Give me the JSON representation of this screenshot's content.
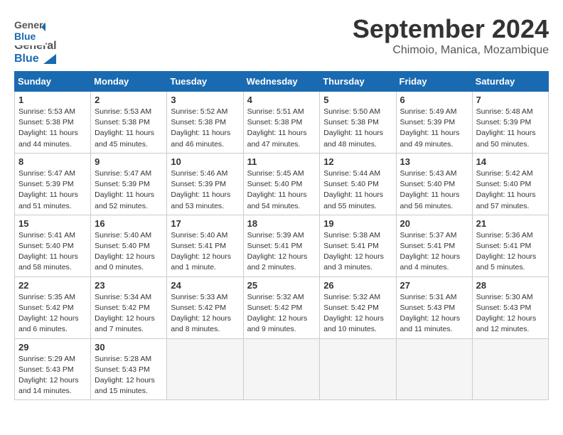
{
  "header": {
    "logo_line1": "General",
    "logo_line2": "Blue",
    "month": "September 2024",
    "location": "Chimoio, Manica, Mozambique"
  },
  "weekdays": [
    "Sunday",
    "Monday",
    "Tuesday",
    "Wednesday",
    "Thursday",
    "Friday",
    "Saturday"
  ],
  "weeks": [
    [
      {
        "day": "1",
        "info": "Sunrise: 5:53 AM\nSunset: 5:38 PM\nDaylight: 11 hours\nand 44 minutes."
      },
      {
        "day": "2",
        "info": "Sunrise: 5:53 AM\nSunset: 5:38 PM\nDaylight: 11 hours\nand 45 minutes."
      },
      {
        "day": "3",
        "info": "Sunrise: 5:52 AM\nSunset: 5:38 PM\nDaylight: 11 hours\nand 46 minutes."
      },
      {
        "day": "4",
        "info": "Sunrise: 5:51 AM\nSunset: 5:38 PM\nDaylight: 11 hours\nand 47 minutes."
      },
      {
        "day": "5",
        "info": "Sunrise: 5:50 AM\nSunset: 5:38 PM\nDaylight: 11 hours\nand 48 minutes."
      },
      {
        "day": "6",
        "info": "Sunrise: 5:49 AM\nSunset: 5:39 PM\nDaylight: 11 hours\nand 49 minutes."
      },
      {
        "day": "7",
        "info": "Sunrise: 5:48 AM\nSunset: 5:39 PM\nDaylight: 11 hours\nand 50 minutes."
      }
    ],
    [
      {
        "day": "8",
        "info": "Sunrise: 5:47 AM\nSunset: 5:39 PM\nDaylight: 11 hours\nand 51 minutes."
      },
      {
        "day": "9",
        "info": "Sunrise: 5:47 AM\nSunset: 5:39 PM\nDaylight: 11 hours\nand 52 minutes."
      },
      {
        "day": "10",
        "info": "Sunrise: 5:46 AM\nSunset: 5:39 PM\nDaylight: 11 hours\nand 53 minutes."
      },
      {
        "day": "11",
        "info": "Sunrise: 5:45 AM\nSunset: 5:40 PM\nDaylight: 11 hours\nand 54 minutes."
      },
      {
        "day": "12",
        "info": "Sunrise: 5:44 AM\nSunset: 5:40 PM\nDaylight: 11 hours\nand 55 minutes."
      },
      {
        "day": "13",
        "info": "Sunrise: 5:43 AM\nSunset: 5:40 PM\nDaylight: 11 hours\nand 56 minutes."
      },
      {
        "day": "14",
        "info": "Sunrise: 5:42 AM\nSunset: 5:40 PM\nDaylight: 11 hours\nand 57 minutes."
      }
    ],
    [
      {
        "day": "15",
        "info": "Sunrise: 5:41 AM\nSunset: 5:40 PM\nDaylight: 11 hours\nand 58 minutes."
      },
      {
        "day": "16",
        "info": "Sunrise: 5:40 AM\nSunset: 5:40 PM\nDaylight: 12 hours\nand 0 minutes."
      },
      {
        "day": "17",
        "info": "Sunrise: 5:40 AM\nSunset: 5:41 PM\nDaylight: 12 hours\nand 1 minute."
      },
      {
        "day": "18",
        "info": "Sunrise: 5:39 AM\nSunset: 5:41 PM\nDaylight: 12 hours\nand 2 minutes."
      },
      {
        "day": "19",
        "info": "Sunrise: 5:38 AM\nSunset: 5:41 PM\nDaylight: 12 hours\nand 3 minutes."
      },
      {
        "day": "20",
        "info": "Sunrise: 5:37 AM\nSunset: 5:41 PM\nDaylight: 12 hours\nand 4 minutes."
      },
      {
        "day": "21",
        "info": "Sunrise: 5:36 AM\nSunset: 5:41 PM\nDaylight: 12 hours\nand 5 minutes."
      }
    ],
    [
      {
        "day": "22",
        "info": "Sunrise: 5:35 AM\nSunset: 5:42 PM\nDaylight: 12 hours\nand 6 minutes."
      },
      {
        "day": "23",
        "info": "Sunrise: 5:34 AM\nSunset: 5:42 PM\nDaylight: 12 hours\nand 7 minutes."
      },
      {
        "day": "24",
        "info": "Sunrise: 5:33 AM\nSunset: 5:42 PM\nDaylight: 12 hours\nand 8 minutes."
      },
      {
        "day": "25",
        "info": "Sunrise: 5:32 AM\nSunset: 5:42 PM\nDaylight: 12 hours\nand 9 minutes."
      },
      {
        "day": "26",
        "info": "Sunrise: 5:32 AM\nSunset: 5:42 PM\nDaylight: 12 hours\nand 10 minutes."
      },
      {
        "day": "27",
        "info": "Sunrise: 5:31 AM\nSunset: 5:43 PM\nDaylight: 12 hours\nand 11 minutes."
      },
      {
        "day": "28",
        "info": "Sunrise: 5:30 AM\nSunset: 5:43 PM\nDaylight: 12 hours\nand 12 minutes."
      }
    ],
    [
      {
        "day": "29",
        "info": "Sunrise: 5:29 AM\nSunset: 5:43 PM\nDaylight: 12 hours\nand 14 minutes."
      },
      {
        "day": "30",
        "info": "Sunrise: 5:28 AM\nSunset: 5:43 PM\nDaylight: 12 hours\nand 15 minutes."
      },
      {
        "day": "",
        "info": ""
      },
      {
        "day": "",
        "info": ""
      },
      {
        "day": "",
        "info": ""
      },
      {
        "day": "",
        "info": ""
      },
      {
        "day": "",
        "info": ""
      }
    ]
  ]
}
